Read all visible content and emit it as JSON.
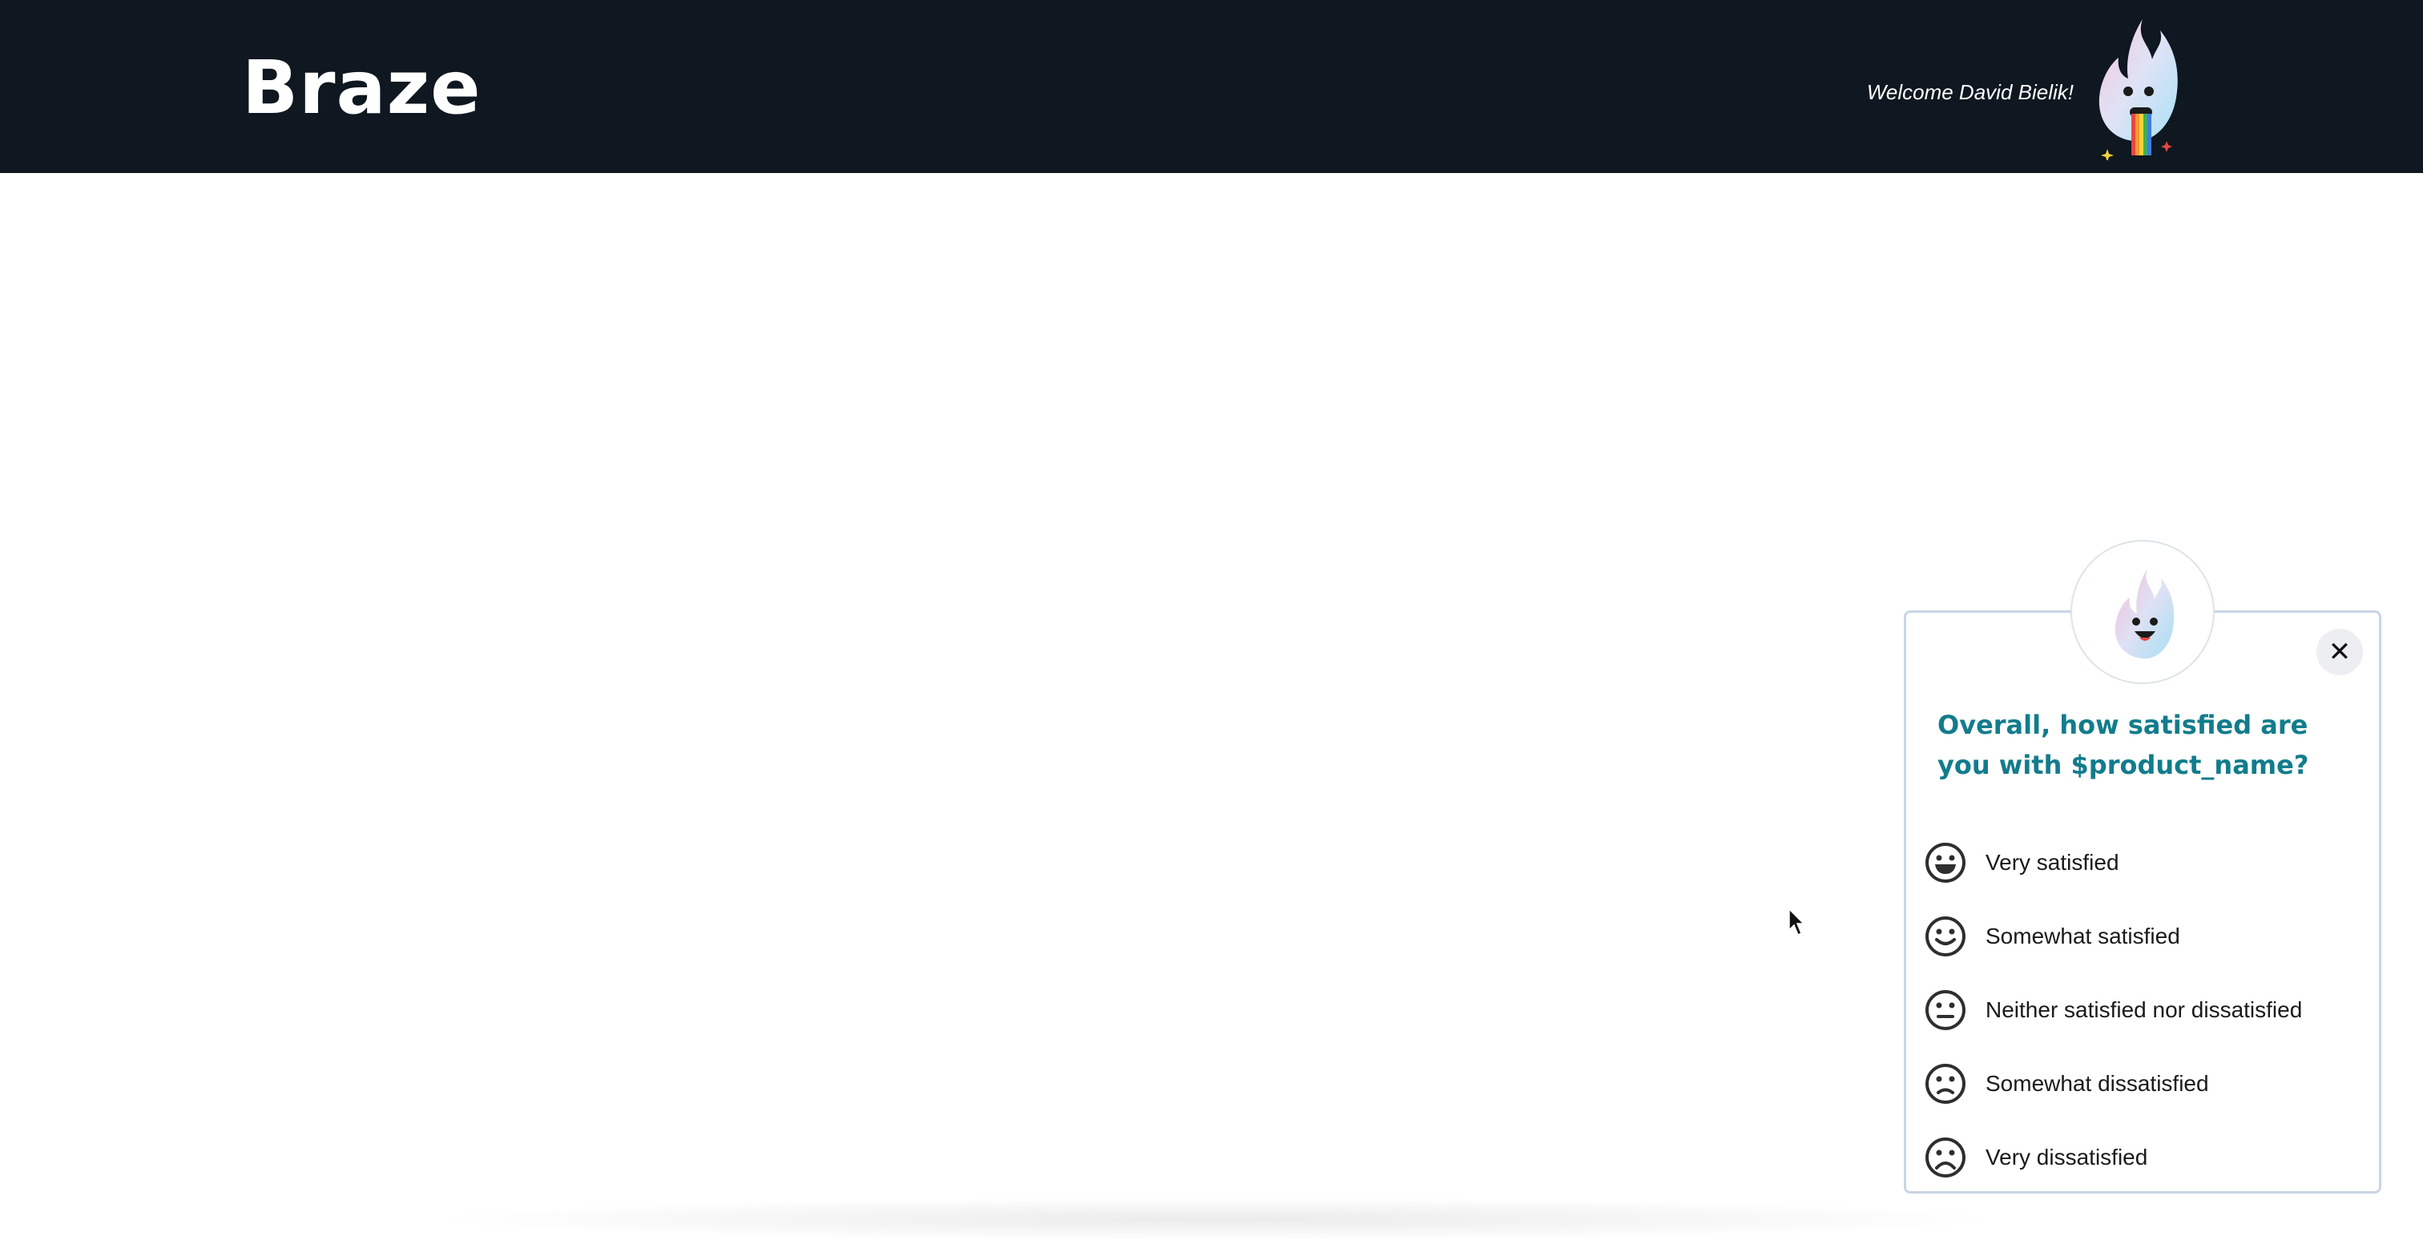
{
  "header": {
    "logo": "Braze",
    "welcome": "Welcome David Bielik!",
    "mascot_icon": "rainbow-flame-mascot-icon",
    "background": "#0f1720"
  },
  "survey": {
    "avatar_icon": "happy-flame-mascot-icon",
    "close_label": "✕",
    "question": "Overall, how satisfied are you with $product_name?",
    "accent_color": "#127c8c",
    "options": [
      {
        "label": "Very satisfied",
        "icon": "grinning-face-icon"
      },
      {
        "label": "Somewhat satisfied",
        "icon": "smiling-face-icon"
      },
      {
        "label": "Neither satisfied nor dissatisfied",
        "icon": "neutral-face-icon"
      },
      {
        "label": "Somewhat dissatisfied",
        "icon": "slightly-frowning-face-icon"
      },
      {
        "label": "Very dissatisfied",
        "icon": "frowning-face-icon"
      }
    ]
  }
}
